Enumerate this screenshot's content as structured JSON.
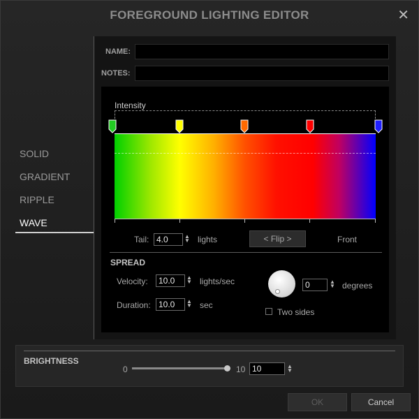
{
  "window": {
    "title": "FOREGROUND LIGHTING EDITOR",
    "close_glyph": "✕"
  },
  "nav": {
    "items": [
      {
        "label": "SOLID",
        "active": false
      },
      {
        "label": "GRADIENT",
        "active": false
      },
      {
        "label": "RIPPLE",
        "active": false
      },
      {
        "label": "WAVE",
        "active": true
      }
    ]
  },
  "form": {
    "name_label": "NAME:",
    "name_value": "",
    "notes_label": "NOTES:",
    "notes_value": ""
  },
  "gradient_editor": {
    "intensity_label": "Intensity",
    "markers": [
      {
        "color": "#22cc22",
        "icon": "marker-green"
      },
      {
        "color": "#ffff00",
        "icon": "marker-yellow"
      },
      {
        "color": "#ff6a00",
        "icon": "marker-orange"
      },
      {
        "color": "#ff0000",
        "icon": "marker-red"
      },
      {
        "color": "#2020ff",
        "icon": "marker-blue"
      }
    ]
  },
  "tail": {
    "label": "Tail:",
    "value": "4.0",
    "unit": "lights"
  },
  "flip_button": "< Flip >",
  "front_label": "Front",
  "spread": {
    "title": "SPREAD",
    "velocity_label": "Velocity:",
    "velocity_value": "10.0",
    "velocity_unit": "lights/sec",
    "duration_label": "Duration:",
    "duration_value": "10.0",
    "duration_unit": "sec",
    "degrees_value": "0",
    "degrees_unit": "degrees",
    "two_sides_label": "Two sides",
    "two_sides_checked": false
  },
  "brightness": {
    "title": "BRIGHTNESS",
    "min_label": "0",
    "max_label": "10",
    "value": "10",
    "level": 1.0
  },
  "buttons": {
    "ok": "OK",
    "cancel": "Cancel",
    "ok_disabled": true
  },
  "colors": {
    "accent": "#ffffff",
    "background": "#1c1c1c",
    "panel": "#000000"
  }
}
